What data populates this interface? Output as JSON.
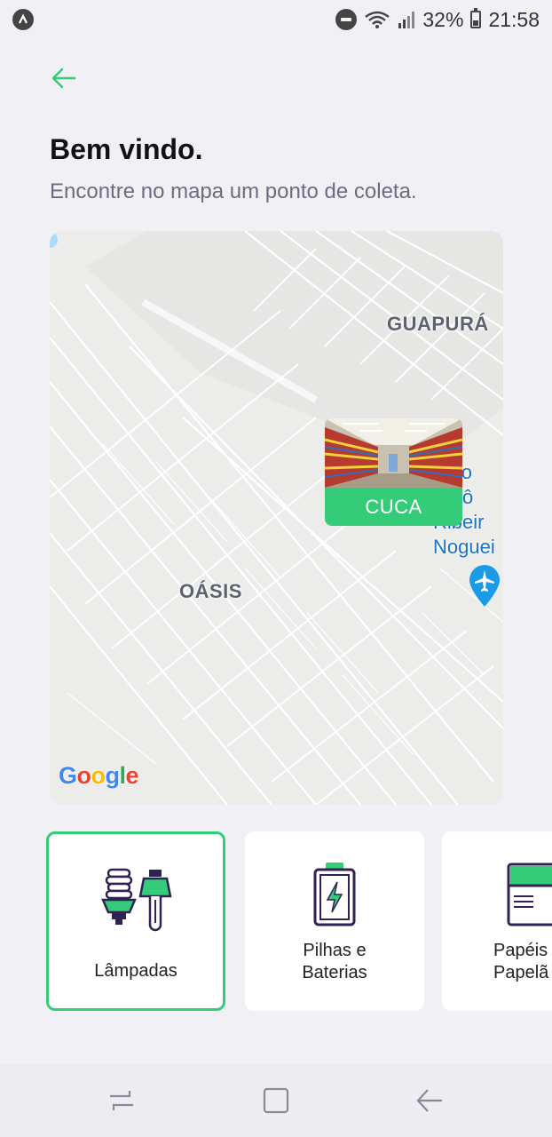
{
  "status_bar": {
    "battery": "32%",
    "time": "21:58",
    "icons": [
      "app-badge-icon",
      "do-not-disturb-icon",
      "wifi-icon",
      "signal-icon",
      "battery-icon"
    ]
  },
  "header": {
    "back_icon": "arrow-left-icon",
    "title": "Bem vindo.",
    "subtitle": "Encontre no mapa um ponto de coleta."
  },
  "map": {
    "labels": {
      "neighborhood_1": "GUAPURÁ",
      "neighborhood_2": "OÁSIS",
      "airport_line1": "ropo",
      "airport_line2": "Antô",
      "airport_line3": "Ribeir",
      "airport_line4": "Noguei"
    },
    "provider": "Google",
    "marker": {
      "label": "CUCA"
    },
    "colors": {
      "accent": "#34cb79",
      "poi": "#1a73c8"
    }
  },
  "items": [
    {
      "label": "Lâmpadas",
      "icon": "lamp-bulbs-icon",
      "selected": true
    },
    {
      "label": "Pilhas e\nBaterias",
      "icon": "battery-charge-icon",
      "selected": false
    },
    {
      "label": "Papéis\nPapelã",
      "icon": "paper-icon",
      "selected": false
    }
  ],
  "navbar": {
    "icons": [
      "recent-apps-icon",
      "home-icon",
      "back-icon"
    ]
  }
}
